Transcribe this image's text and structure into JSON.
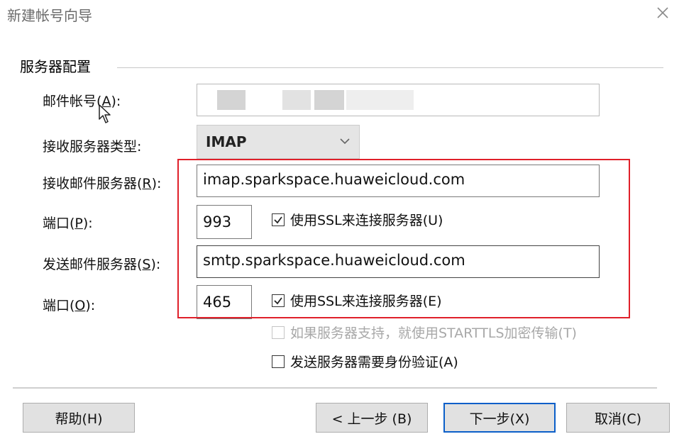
{
  "dialog": {
    "title": "新建帐号向导"
  },
  "group": {
    "title": "服务器配置"
  },
  "account": {
    "label": "邮件帐号",
    "accel": "A",
    "suffix": "):",
    "value": ""
  },
  "server_type": {
    "label": "接收服务器类型:",
    "value": "IMAP"
  },
  "incoming": {
    "label": "接收邮件服务器(",
    "accel": "R",
    "suffix": "):",
    "value": "imap.sparkspace.huaweicloud.com"
  },
  "incoming_port": {
    "label": "端口(",
    "accel": "P",
    "suffix": "):",
    "value": "993",
    "ssl_label": "使用SSL来连接服务器(U)",
    "ssl_checked": true
  },
  "outgoing": {
    "label": "发送邮件服务器(",
    "accel": "S",
    "suffix": "):",
    "value": "smtp.sparkspace.huaweicloud.com"
  },
  "outgoing_port": {
    "label": "端口(",
    "accel": "O",
    "suffix": "):",
    "value": "465",
    "ssl_label": "使用SSL来连接服务器(E)",
    "ssl_checked": true
  },
  "starttls": {
    "label": "如果服务器支持，就使用STARTTLS加密传输(T)",
    "checked": false,
    "disabled": true
  },
  "auth": {
    "label": "发送服务器需要身份验证(A)",
    "checked": false
  },
  "buttons": {
    "help": "帮助(H)",
    "back": "< 上一步 (B)",
    "next": "下一步(X)",
    "cancel": "取消(C)"
  },
  "colors": {
    "highlight": "#e0202a",
    "default_button_border": "#0a5fc9",
    "select_bg": "#e5e5e5"
  }
}
